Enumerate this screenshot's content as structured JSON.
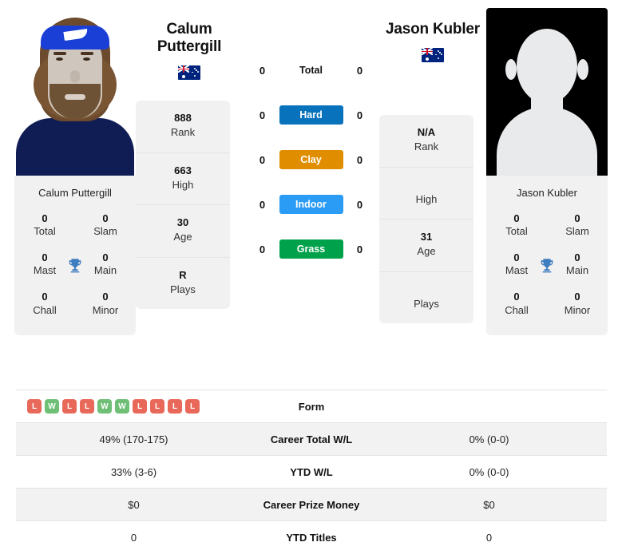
{
  "players": {
    "left": {
      "name": "Calum Puttergill",
      "name_line1": "Calum",
      "name_line2": "Puttergill",
      "country": "Australia",
      "flag_icon": "australia-flag-icon",
      "card_name": "Calum Puttergill",
      "titles": [
        {
          "value": "0",
          "label": "Total"
        },
        {
          "value": "0",
          "label": "Slam"
        },
        {
          "value": "0",
          "label": "Mast"
        },
        {
          "value": "0",
          "label": "Main"
        },
        {
          "value": "0",
          "label": "Chall"
        },
        {
          "value": "0",
          "label": "Minor"
        }
      ],
      "stats": [
        {
          "value": "888",
          "label": "Rank"
        },
        {
          "value": "663",
          "label": "High"
        },
        {
          "value": "30",
          "label": "Age"
        },
        {
          "value": "R",
          "label": "Plays"
        }
      ]
    },
    "right": {
      "name": "Jason Kubler",
      "name_line1": "Jason Kubler",
      "name_line2": "",
      "country": "Australia",
      "flag_icon": "australia-flag-icon",
      "card_name": "Jason Kubler",
      "titles": [
        {
          "value": "0",
          "label": "Total"
        },
        {
          "value": "0",
          "label": "Slam"
        },
        {
          "value": "0",
          "label": "Mast"
        },
        {
          "value": "0",
          "label": "Main"
        },
        {
          "value": "0",
          "label": "Chall"
        },
        {
          "value": "0",
          "label": "Minor"
        }
      ],
      "stats": [
        {
          "value": "N/A",
          "label": "Rank"
        },
        {
          "value": "",
          "label": "High"
        },
        {
          "value": "31",
          "label": "Age"
        },
        {
          "value": "",
          "label": "Plays"
        }
      ]
    }
  },
  "surfaces": [
    {
      "label": "Total",
      "left": "0",
      "right": "0",
      "color": "",
      "plain": true
    },
    {
      "label": "Hard",
      "left": "0",
      "right": "0",
      "color": "#0872bc",
      "plain": false
    },
    {
      "label": "Clay",
      "left": "0",
      "right": "0",
      "color": "#e08e00",
      "plain": false
    },
    {
      "label": "Indoor",
      "left": "0",
      "right": "0",
      "color": "#2b9cf5",
      "plain": false
    },
    {
      "label": "Grass",
      "left": "0",
      "right": "0",
      "color": "#00a14b",
      "plain": false
    }
  ],
  "form": {
    "label": "Form",
    "results": [
      "L",
      "W",
      "L",
      "L",
      "W",
      "W",
      "L",
      "L",
      "L",
      "L"
    ],
    "win_color": "#6fbf77",
    "loss_color": "#e8685a"
  },
  "table": [
    {
      "label": "Career Total W/L",
      "left": "49% (170-175)",
      "right": "0% (0-0)"
    },
    {
      "label": "YTD W/L",
      "left": "33% (3-6)",
      "right": "0% (0-0)"
    },
    {
      "label": "Career Prize Money",
      "left": "$0",
      "right": "$0"
    },
    {
      "label": "YTD Titles",
      "left": "0",
      "right": "0"
    }
  ],
  "icons": {
    "trophy": "trophy-icon"
  }
}
